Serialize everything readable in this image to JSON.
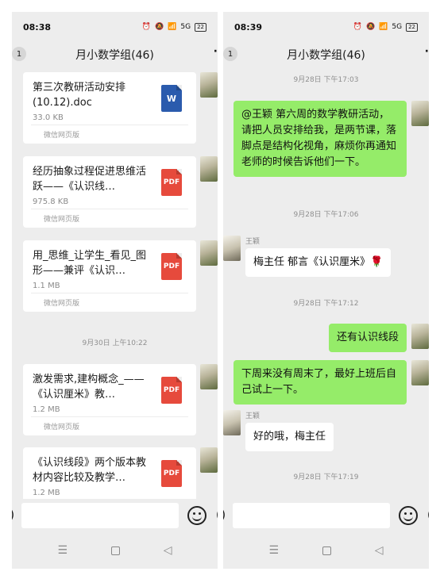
{
  "left": {
    "status": {
      "time": "08:38",
      "signal": "5G",
      "battery": "22"
    },
    "header": {
      "title": "月小数学组(46)",
      "badge": "1",
      "more": "·"
    },
    "files": [
      {
        "name": "第三次教研活动安排(10.12).doc",
        "size": "33.0 KB",
        "source": "微信网页版",
        "type": "W",
        "icon": "word-icon"
      },
      {
        "name": "经历抽象过程促进思维活跃——《认识线…",
        "size": "975.8 KB",
        "source": "微信网页版",
        "type": "PDF",
        "icon": "pdf-icon"
      },
      {
        "name": "用_思维_让学生_看见_图形——兼评《认识…",
        "size": "1.1 MB",
        "source": "微信网页版",
        "type": "PDF",
        "icon": "pdf-icon"
      },
      {
        "name": "激发需求,建构概念_——《认识厘米》教…",
        "size": "1.2 MB",
        "source": "微信网页版",
        "type": "PDF",
        "icon": "pdf-icon"
      },
      {
        "name": "《认识线段》两个版本教材内容比较及教学…",
        "size": "1.2 MB",
        "source": "",
        "type": "PDF",
        "icon": "pdf-icon"
      }
    ],
    "timestamp": "9月30日 上午10:22"
  },
  "right": {
    "status": {
      "time": "08:39",
      "signal": "5G",
      "battery": "22"
    },
    "header": {
      "title": "月小数学组(46)",
      "badge": "1",
      "more": "·"
    },
    "timestamps": [
      "9月28日 下午17:03",
      "9月28日 下午17:06",
      "9月28日 下午17:12",
      "9月28日 下午17:19"
    ],
    "messages": [
      {
        "text": "@王颖  第六周的数学教研活动，请把人员安排给我，是两节课，落脚点是结构化视角，麻烦你再通知老师的时候告诉他们一下。",
        "side": "right"
      },
      {
        "sender": "王颖",
        "text": "梅主任  郁言《认识厘米》🌹",
        "side": "left"
      },
      {
        "text": "还有认识线段",
        "side": "right"
      },
      {
        "text": "下周来没有周末了，最好上班后自己试上一下。",
        "side": "right"
      },
      {
        "sender": "王颖",
        "text": "好的哦，梅主任",
        "side": "left"
      }
    ]
  },
  "input": {
    "paren_left": ")",
    "paren_right": "("
  },
  "nav": {
    "menu": "☰",
    "back": "◁"
  }
}
